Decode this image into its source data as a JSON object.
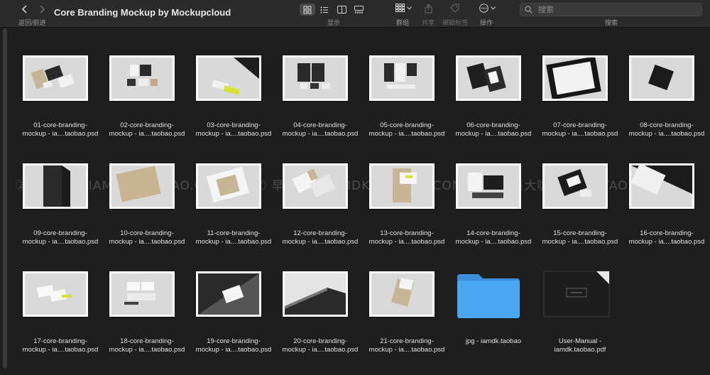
{
  "toolbar": {
    "back_icon": "chevron-left",
    "forward_icon": "chevron-right",
    "nav_label": "返回/前进",
    "title": "Core Branding Mockup by Mockupcloud",
    "view_label": "显示",
    "group_label": "群组",
    "share_label": "共享",
    "tags_label": "编辑标签",
    "action_label": "操作",
    "search_placeholder": "搜索",
    "search_label": "搜索"
  },
  "watermark": "Ⓩ 早道大咖 IAMDK.TAOBAO.COM",
  "files": [
    {
      "line1": "01-core-branding-",
      "line2": "mockup - ia....taobao.psd",
      "kind": "image",
      "scene": "a"
    },
    {
      "line1": "02-core-branding-",
      "line2": "mockup - ia....taobao.psd",
      "kind": "image",
      "scene": "b"
    },
    {
      "line1": "03-core-branding-",
      "line2": "mockup - ia....taobao.psd",
      "kind": "image",
      "scene": "c"
    },
    {
      "line1": "04-core-branding-",
      "line2": "mockup - ia....taobao.psd",
      "kind": "image",
      "scene": "d"
    },
    {
      "line1": "05-core-branding-",
      "line2": "mockup - ia....taobao.psd",
      "kind": "image",
      "scene": "e"
    },
    {
      "line1": "06-core-branding-",
      "line2": "mockup - ia....taobao.psd",
      "kind": "image",
      "scene": "f"
    },
    {
      "line1": "07-core-branding-",
      "line2": "mockup - ia....taobao.psd",
      "kind": "image",
      "scene": "g"
    },
    {
      "line1": "08-core-branding-",
      "line2": "mockup - ia....taobao.psd",
      "kind": "image",
      "scene": "h"
    },
    {
      "line1": "09-core-branding-",
      "line2": "mockup - ia....taobao.psd",
      "kind": "image",
      "scene": "i"
    },
    {
      "line1": "10-core-branding-",
      "line2": "mockup - ia....taobao.psd",
      "kind": "image",
      "scene": "j"
    },
    {
      "line1": "11-core-branding-",
      "line2": "mockup - ia....taobao.psd",
      "kind": "image",
      "scene": "k"
    },
    {
      "line1": "12-core-branding-",
      "line2": "mockup - ia....taobao.psd",
      "kind": "image",
      "scene": "l"
    },
    {
      "line1": "13-core-branding-",
      "line2": "mockup - ia....taobao.psd",
      "kind": "image",
      "scene": "m"
    },
    {
      "line1": "14-core-branding-",
      "line2": "mockup - ia....taobao.psd",
      "kind": "image",
      "scene": "n"
    },
    {
      "line1": "15-core-branding-",
      "line2": "mockup - ia....taobao.psd",
      "kind": "image",
      "scene": "o"
    },
    {
      "line1": "16-core-branding-",
      "line2": "mockup - ia....taobao.psd",
      "kind": "image",
      "scene": "p"
    },
    {
      "line1": "17-core-branding-",
      "line2": "mockup - ia....taobao.psd",
      "kind": "image",
      "scene": "q"
    },
    {
      "line1": "18-core-branding-",
      "line2": "mockup - ia....taobao.psd",
      "kind": "image",
      "scene": "r"
    },
    {
      "line1": "19-core-branding-",
      "line2": "mockup - ia....taobao.psd",
      "kind": "image",
      "scene": "s"
    },
    {
      "line1": "20-core-branding-",
      "line2": "mockup - ia....taobao.psd",
      "kind": "image",
      "scene": "t"
    },
    {
      "line1": "21-core-branding-",
      "line2": "mockup - ia....taobao.psd",
      "kind": "image",
      "scene": "u"
    },
    {
      "line1": "jpg - iamdk.taobao",
      "line2": "",
      "kind": "folder",
      "scene": "folder"
    },
    {
      "line1": "User-Manual -",
      "line2": "iamdk.taobao.pdf",
      "kind": "pdf",
      "scene": "pdf"
    }
  ],
  "colors": {
    "background": "#1e1e1e",
    "toolbar": "#2b2b2b",
    "folder_blue": "#4aa8f0",
    "accent_yellow": "#d7e23a"
  }
}
